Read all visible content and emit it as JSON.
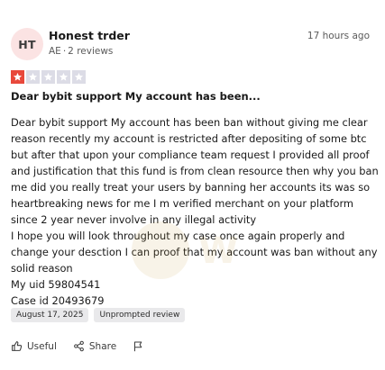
{
  "review": {
    "avatar_initials": "HT",
    "reviewer_name": "Honest trder",
    "country": "AE",
    "reviews_count": "2 reviews",
    "time_ago": "17 hours ago",
    "rating": {
      "value": 1,
      "max": 5,
      "filled_color": "#e8483b",
      "empty_color": "#dcdce6"
    },
    "title": "Dear bybit support My account has been...",
    "body_lines": [
      "Dear bybit support My account has been ban without giving me clear reason recently my account is restricted after depositing of some btc but after that upon your compliance team request I provided all proof and justification that this fund is from clean resource then why you ban me did you really treat your users by banning her accounts its was so heartbreaking news for me I m verified merchant on your platform since 2 year never involve in any illegal activity",
      "I hope you will look throughout my case once again properly and change your desction I can proof that my account was ban without any solid reason",
      "My uid 59804541",
      "Case id 20493679"
    ],
    "tags": [
      "August 17, 2025",
      "Unprompted review"
    ],
    "actions": {
      "useful": "Useful",
      "share": "Share"
    },
    "icons": {
      "useful": "thumbs-up-icon",
      "share": "share-icon",
      "flag": "flag-icon"
    }
  }
}
